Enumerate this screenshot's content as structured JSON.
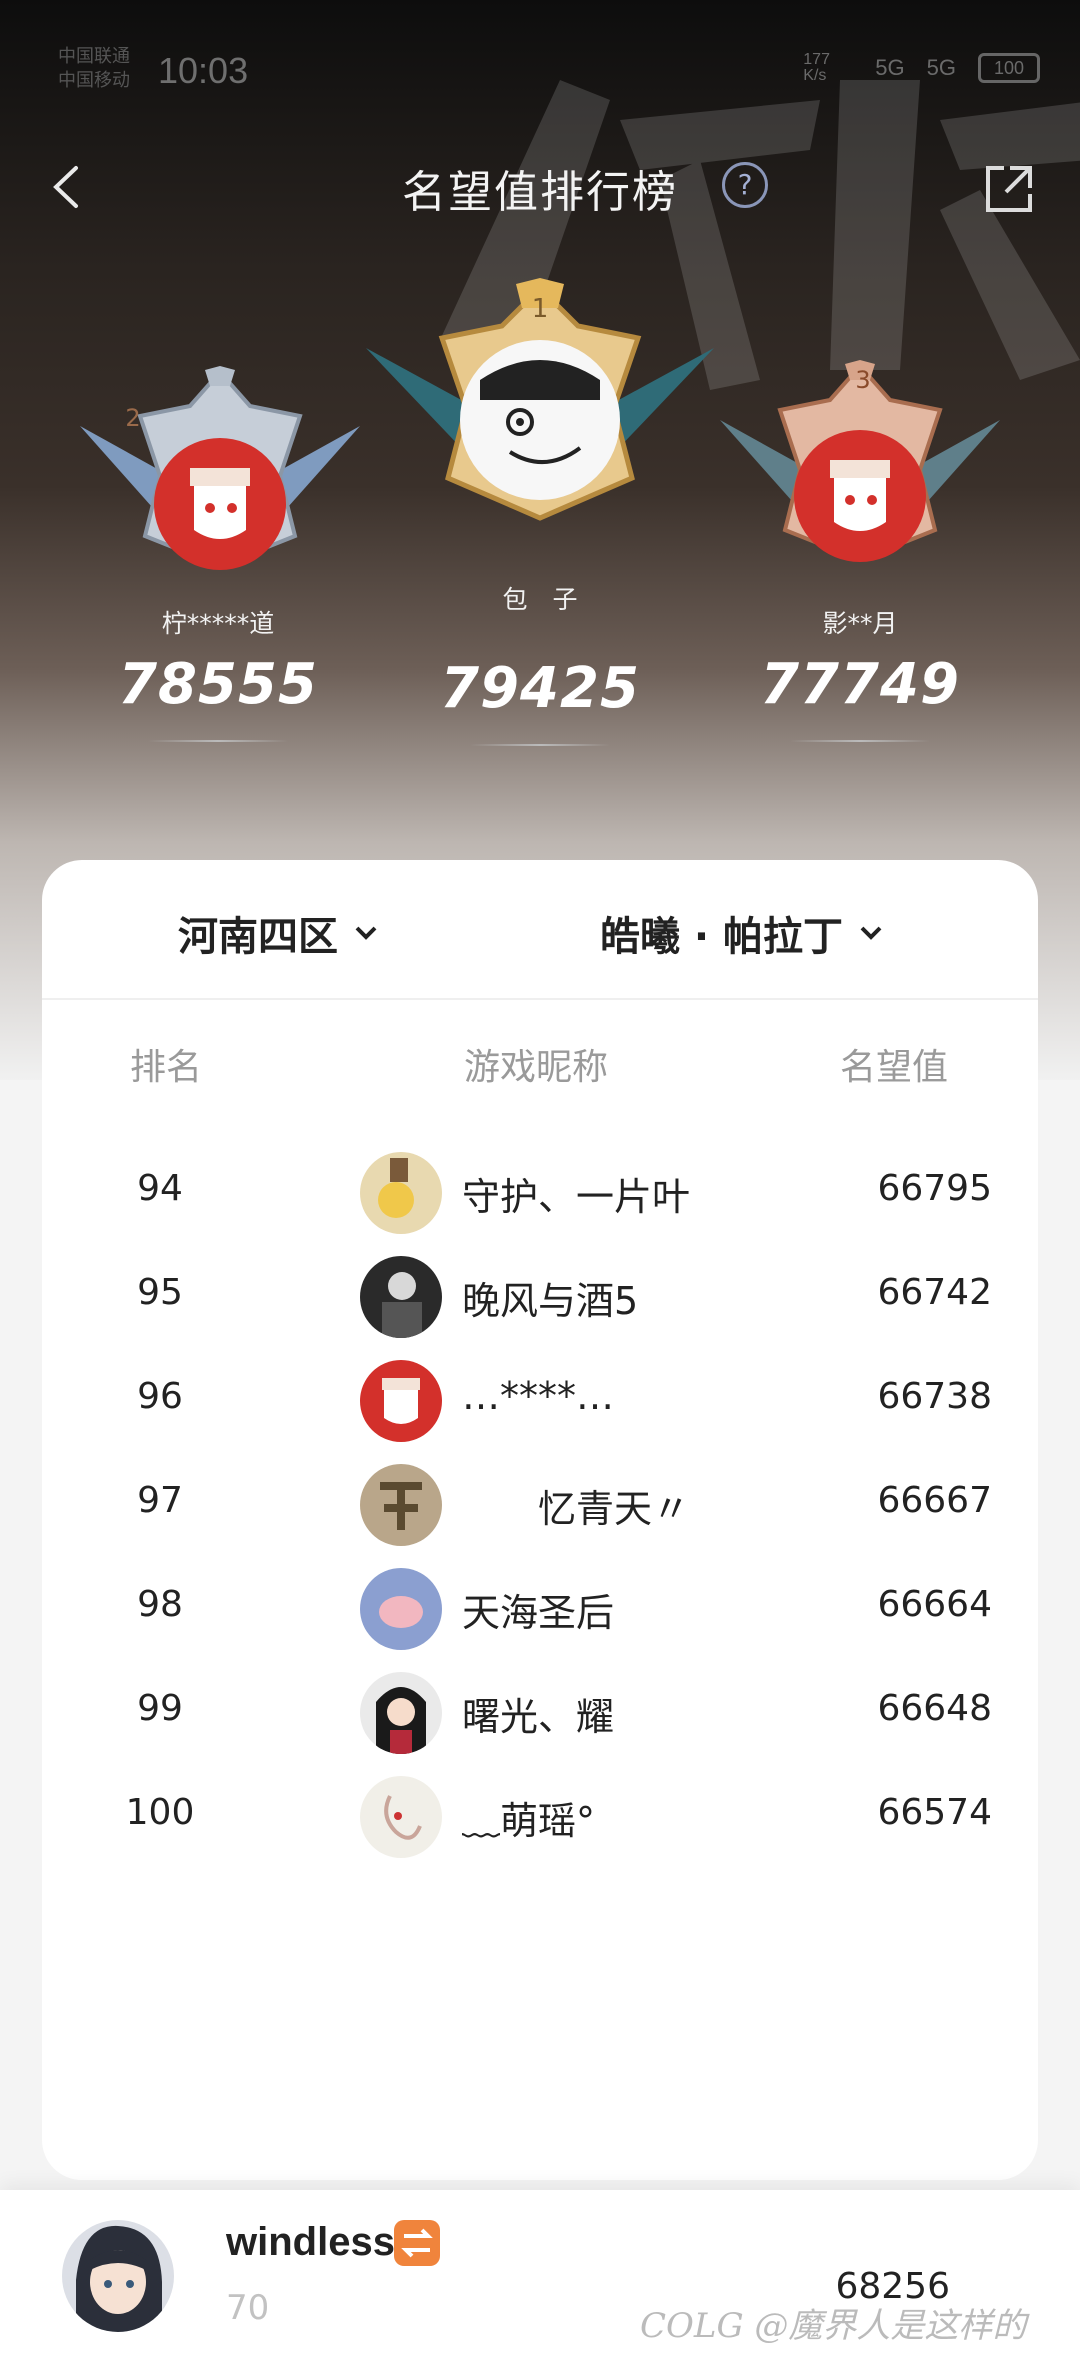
{
  "status": {
    "carrier_lines": [
      "中国联通",
      "中国移动"
    ],
    "time": "10:03",
    "speed": "177 K/s",
    "signal1": "5G",
    "signal2": "5G",
    "battery": "100"
  },
  "nav": {
    "title": "名望值排行榜",
    "help_glyph": "?"
  },
  "podium": [
    {
      "place": "1",
      "name": "包　子",
      "score": "79425"
    },
    {
      "place": "2",
      "name": "柠*****道",
      "score": "78555"
    },
    {
      "place": "3",
      "name": "影**月",
      "score": "77749"
    }
  ],
  "filters": {
    "region": "河南四区",
    "class": "皓曦 · 帕拉丁"
  },
  "table": {
    "headers": {
      "rank": "排名",
      "name": "游戏昵称",
      "score": "名望值"
    },
    "rows": [
      {
        "rank": "94",
        "name": "守护、一片叶",
        "score": "66795"
      },
      {
        "rank": "95",
        "name": "晚风与酒5",
        "score": "66742"
      },
      {
        "rank": "96",
        "name": "…****…",
        "score": "66738"
      },
      {
        "rank": "97",
        "name": "　　忆青天〃",
        "score": "66667"
      },
      {
        "rank": "98",
        "name": "天海圣后",
        "score": "66664"
      },
      {
        "rank": "99",
        "name": "曙光、耀",
        "score": "66648"
      },
      {
        "rank": "100",
        "name": "﹏萌瑶°",
        "score": "66574"
      }
    ]
  },
  "me": {
    "name": "windless",
    "rank": "70",
    "score": "68256"
  },
  "watermark": "COLG @魔界人是这样的"
}
